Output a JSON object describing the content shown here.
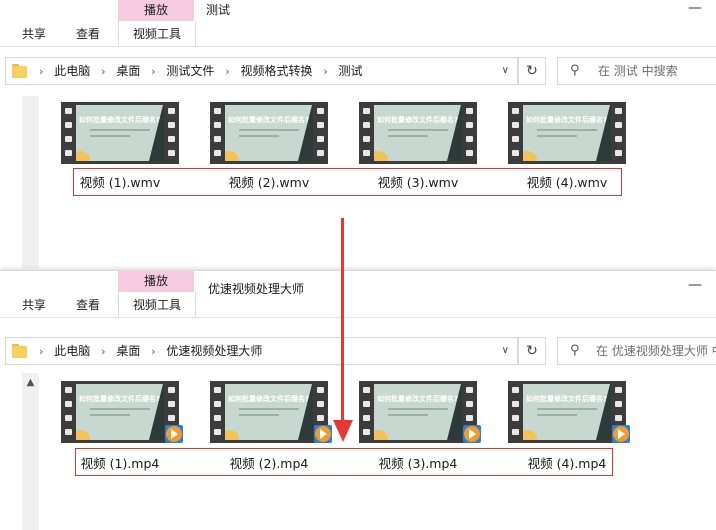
{
  "top_window": {
    "tabs": {
      "play_tool": "播放",
      "share": "共享",
      "view": "查看",
      "video_tools": "视频工具"
    },
    "title": "测试",
    "minimize": "—",
    "breadcrumb": [
      "此电脑",
      "桌面",
      "测试文件",
      "视频格式转换",
      "测试"
    ],
    "search_placeholder": "在 测试 中搜索",
    "files": [
      {
        "name": "视频 (1).wmv",
        "thumb_title": "如何批量修改文件后缀名?"
      },
      {
        "name": "视频 (2).wmv",
        "thumb_title": "如何批量修改文件后缀名?"
      },
      {
        "name": "视频 (3).wmv",
        "thumb_title": "如何批量修改文件后缀名?"
      },
      {
        "name": "视频 (4).wmv",
        "thumb_title": "如何批量修改文件后缀名?"
      }
    ]
  },
  "bottom_window": {
    "tabs": {
      "play_tool": "播放",
      "share": "共享",
      "view": "查看",
      "video_tools": "视频工具"
    },
    "title": "优速视频处理大师",
    "minimize": "—",
    "breadcrumb": [
      "此电脑",
      "桌面",
      "优速视频处理大师"
    ],
    "search_placeholder": "在 优速视频处理大师 中",
    "files": [
      {
        "name": "视频 (1).mp4",
        "thumb_title": "如何批量修改文件后缀名?"
      },
      {
        "name": "视频 (2).mp4",
        "thumb_title": "如何批量修改文件后缀名?"
      },
      {
        "name": "视频 (3).mp4",
        "thumb_title": "如何批量修改文件后缀名?"
      },
      {
        "name": "视频 (4).mp4",
        "thumb_title": "如何批量修改文件后缀名?"
      }
    ]
  },
  "icons": {
    "folder": "folder-icon",
    "dropdown": "chevron-down-icon",
    "refresh": "refresh-icon",
    "search": "search-icon",
    "play": "play-badge-icon",
    "scroll_up": "scroll-up-icon"
  },
  "symbols": {
    "separator": "›",
    "dropdown": "∨",
    "refresh": "↻",
    "search": "⚲",
    "scroll_up": "▲"
  },
  "colors": {
    "accent_tab": "#f6cbe0",
    "highlight": "#e03333",
    "folder": "#f6cf5c"
  }
}
